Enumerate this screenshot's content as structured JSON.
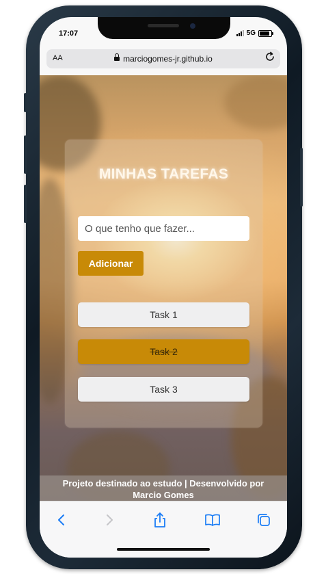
{
  "status_bar": {
    "time": "17:07",
    "network": "5G"
  },
  "browser": {
    "text_size_label": "AA",
    "url": "marciogomes-jr.github.io",
    "reload_icon": "reload-icon"
  },
  "app": {
    "title": "MINHAS TAREFAS",
    "input_placeholder": "O que tenho que fazer...",
    "add_button_label": "Adicionar",
    "tasks": [
      {
        "label": "Task 1",
        "completed": false
      },
      {
        "label": "Task 2",
        "completed": true
      },
      {
        "label": "Task 3",
        "completed": false
      }
    ],
    "footer_line1": "Projeto destinado ao estudo | Desenvolvido por",
    "footer_line2": "Marcio Gomes"
  },
  "toolbar": {
    "icons": [
      "back-icon",
      "forward-icon",
      "share-icon",
      "bookmarks-icon",
      "tabs-icon"
    ]
  },
  "colors": {
    "accent": "#c88a07",
    "task_bg": "#efeff0",
    "frame": "#1a2834"
  }
}
